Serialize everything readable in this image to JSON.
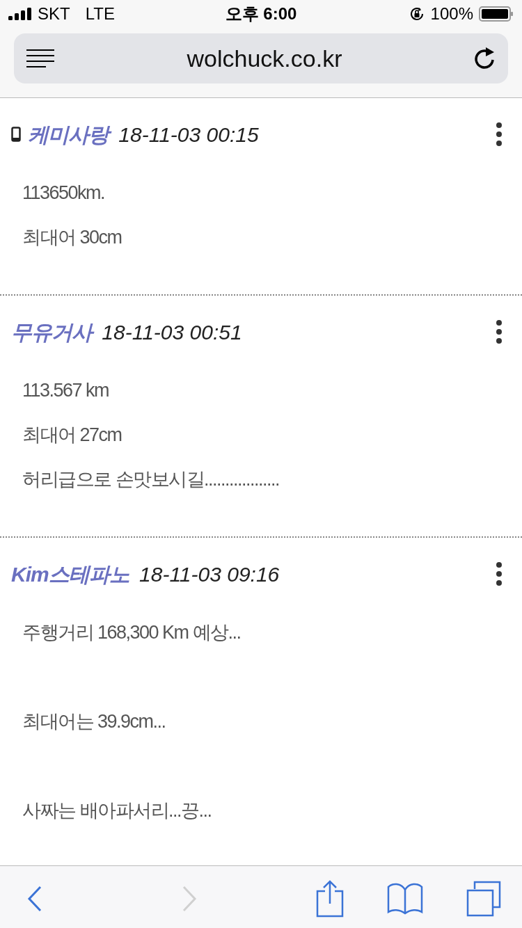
{
  "status_bar": {
    "carrier": "SKT",
    "network": "LTE",
    "time": "오후 6:00",
    "battery": "100%"
  },
  "address_bar": {
    "url": "wolchuck.co.kr"
  },
  "comments": [
    {
      "author": "케미사랑",
      "mobile": true,
      "date": "18-11-03 00:15",
      "lines": [
        {
          "text": "113650km.",
          "gap_before": false
        },
        {
          "text": "최대어 30cm",
          "gap_before": false
        }
      ]
    },
    {
      "author": "무유거사",
      "mobile": false,
      "date": "18-11-03 00:51",
      "lines": [
        {
          "text": "113.567 km",
          "gap_before": false
        },
        {
          "text": "최대어 27cm",
          "gap_before": false
        },
        {
          "text": "허리급으로 손맛보시길..................",
          "gap_before": false
        }
      ]
    },
    {
      "author": "Kim스테파노",
      "mobile": false,
      "date": "18-11-03 09:16",
      "lines": [
        {
          "text": "주행거리 168,300 Km 예상...",
          "gap_before": false
        },
        {
          "text": "최대어는 39.9cm...",
          "gap_before": true
        },
        {
          "text": "사짜는 배아파서리...끙...",
          "gap_before": true
        }
      ]
    }
  ],
  "toolbar": {
    "back_disabled": false,
    "forward_disabled": true
  }
}
